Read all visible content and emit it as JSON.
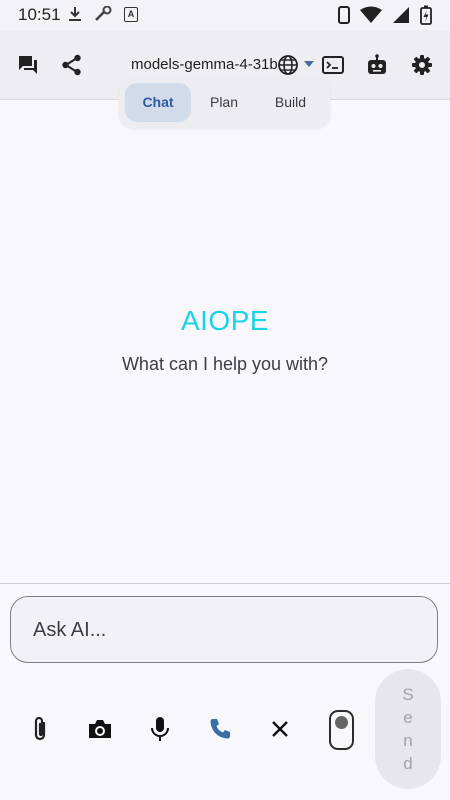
{
  "status_bar": {
    "time": "10:51"
  },
  "app_bar": {
    "model_name": "models-gemma-4-31b-it"
  },
  "modes": [
    {
      "label": "Chat",
      "active": true
    },
    {
      "label": "Plan",
      "active": false
    },
    {
      "label": "Build",
      "active": false
    }
  ],
  "main": {
    "brand": "AIOPE",
    "prompt": "What can I help you with?"
  },
  "composer": {
    "placeholder": "Ask AI...",
    "send_letters": [
      "S",
      "e",
      "n",
      "d"
    ]
  },
  "colors": {
    "brand": "#1ad3e6",
    "active_mode_text": "#2f5aa8",
    "active_mode_bg": "#d2dbea",
    "phone_icon": "#3a6ea5"
  },
  "icons": {
    "app_bar": [
      "chat-icon",
      "share-icon",
      "globe-icon",
      "terminal-icon",
      "robot-icon",
      "settings-icon"
    ],
    "toolbar": [
      "attach-icon",
      "camera-icon",
      "microphone-icon",
      "phone-icon",
      "close-icon",
      "toggle-switch"
    ]
  }
}
